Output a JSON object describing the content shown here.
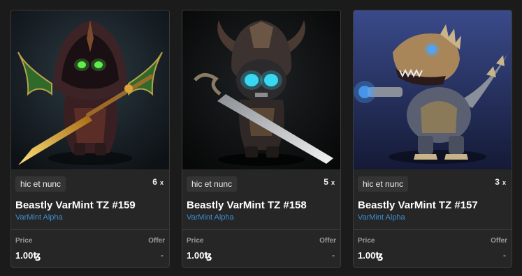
{
  "cards": [
    {
      "marketplace": "hic et nunc",
      "quantity": "6",
      "qty_suffix": "x",
      "title": "Beastly VarMint TZ #159",
      "collection": "VarMint Alpha",
      "price_label": "Price",
      "offer_label": "Offer",
      "price": "1.00ꜩ",
      "offer": "-",
      "eye_color": "#5cf04a"
    },
    {
      "marketplace": "hic et nunc",
      "quantity": "5",
      "qty_suffix": "x",
      "title": "Beastly VarMint TZ #158",
      "collection": "VarMint Alpha",
      "price_label": "Price",
      "offer_label": "Offer",
      "price": "1.00ꜩ",
      "offer": "-",
      "eye_color": "#39d8f2"
    },
    {
      "marketplace": "hic et nunc",
      "quantity": "3",
      "qty_suffix": "x",
      "title": "Beastly VarMint TZ #157",
      "collection": "VarMint Alpha",
      "price_label": "Price",
      "offer_label": "Offer",
      "price": "1.00ꜩ",
      "offer": "-",
      "eye_color": "#4da6ff"
    }
  ],
  "colors": {
    "link": "#3d8fd1",
    "card_bg": "#262626",
    "page_bg": "#1b1b1b"
  }
}
